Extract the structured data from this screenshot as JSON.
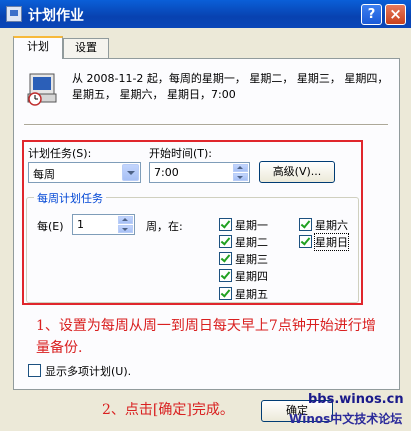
{
  "window": {
    "title": "计划作业",
    "help_button": "?",
    "close_button": "×"
  },
  "tabs": [
    {
      "label": "计划"
    },
    {
      "label": "设置"
    }
  ],
  "schedule_summary": "从 2008-11-2 起，每周的星期一， 星期二， 星期三， 星期四， 星期五， 星期六， 星期日，7:00",
  "task": {
    "label": "计划任务(S):",
    "selected": "每周"
  },
  "start_time": {
    "label": "开始时间(T):",
    "value": "7:00"
  },
  "advanced_button": "高级(V)...",
  "weekly": {
    "group_title": "每周计划任务",
    "every_label": "每(E)",
    "every_value": "1",
    "weeks_on_label": "周，在:",
    "days": [
      {
        "label": "星期一",
        "checked": true
      },
      {
        "label": "星期二",
        "checked": true
      },
      {
        "label": "星期三",
        "checked": true
      },
      {
        "label": "星期四",
        "checked": true
      },
      {
        "label": "星期五",
        "checked": true
      },
      {
        "label": "星期六",
        "checked": true
      },
      {
        "label": "星期日",
        "checked": true
      }
    ]
  },
  "annotation1": "1、设置为每周从周一到周日每天早上7点钟开始进行增量备份.",
  "show_multiple": {
    "label": "显示多项计划(U).",
    "checked": false
  },
  "annotation2": "2、点击[确定]完成。",
  "ok_button": "确定",
  "watermark": {
    "line1": "bbs.winos.cn",
    "line2": "Winos中文技术论坛"
  },
  "colors": {
    "annotation_red": "#e0262c",
    "titlebar_blue": "#0842b0",
    "group_title_blue": "#0046d5"
  }
}
